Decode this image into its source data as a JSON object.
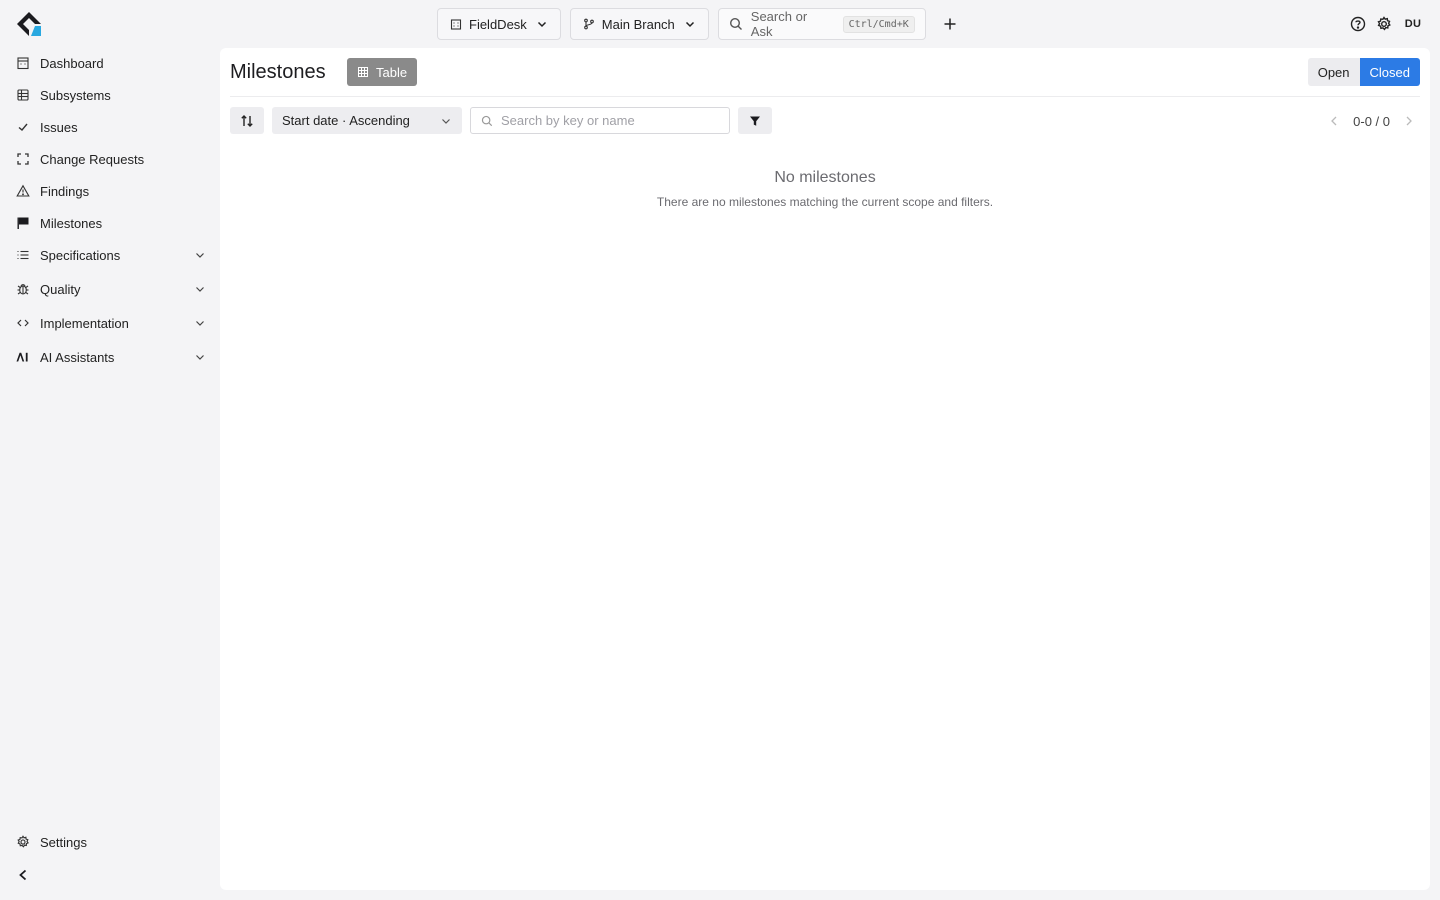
{
  "topbar": {
    "project": "FieldDesk",
    "branch": "Main Branch",
    "search_label": "Search or Ask",
    "search_shortcut": "Ctrl/Cmd+K",
    "user_initials": "DU"
  },
  "sidebar": {
    "items": [
      {
        "label": "Dashboard",
        "icon": "dashboard-icon"
      },
      {
        "label": "Subsystems",
        "icon": "subsystems-icon"
      },
      {
        "label": "Issues",
        "icon": "check-icon"
      },
      {
        "label": "Change Requests",
        "icon": "change-requests-icon"
      },
      {
        "label": "Findings",
        "icon": "warning-icon"
      },
      {
        "label": "Milestones",
        "icon": "flag-icon"
      },
      {
        "label": "Specifications",
        "icon": "list-icon",
        "expandable": true
      },
      {
        "label": "Quality",
        "icon": "bug-icon",
        "expandable": true
      },
      {
        "label": "Implementation",
        "icon": "code-icon",
        "expandable": true
      },
      {
        "label": "AI Assistants",
        "icon": "ai-icon",
        "expandable": true
      }
    ],
    "settings_label": "Settings"
  },
  "main": {
    "title": "Milestones",
    "view_label": "Table",
    "state_filter": {
      "open_label": "Open",
      "closed_label": "Closed",
      "selected": "Closed"
    },
    "sort_label": "Start date · Ascending",
    "search_placeholder": "Search by key or name",
    "pagination": "0-0 / 0",
    "empty_title": "No milestones",
    "empty_description": "There are no milestones matching the current scope and filters."
  },
  "colors": {
    "accent": "#2c7be5",
    "logo_accent": "#29a8e0",
    "view_badge": "#8a8a8a"
  }
}
